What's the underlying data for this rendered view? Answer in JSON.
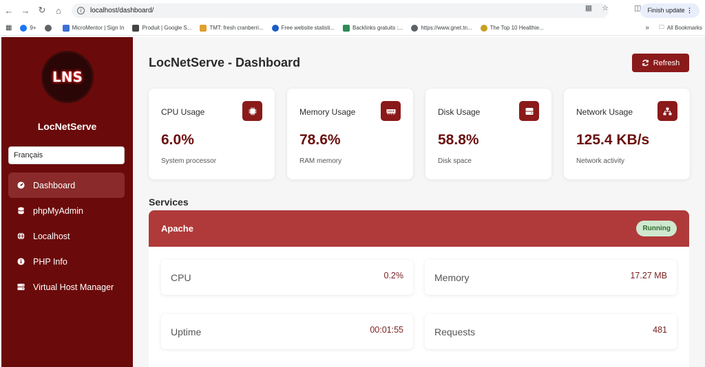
{
  "browser": {
    "url": "localhost/dashboard/",
    "finish_update": "Finish update",
    "bookmarks": [
      {
        "label": "9+",
        "color": "#1877f2"
      },
      {
        "label": "",
        "color": "#5f6368"
      },
      {
        "label": "MicroMentor | Sign In",
        "color": "#3b6fd4"
      },
      {
        "label": "Produit | Google S...",
        "color": "#444444"
      },
      {
        "label": "TMT: fresh cranberri...",
        "color": "#e0a030"
      },
      {
        "label": "Free website statisti...",
        "color": "#1a5cc8"
      },
      {
        "label": "Backlinks gratuits :...",
        "color": "#2e8b57"
      },
      {
        "label": "https://www.gnet.tn...",
        "color": "#5f6368"
      },
      {
        "label": "The Top 10 Healthie...",
        "color": "#c8a020"
      }
    ],
    "overflow": "»",
    "all_bookmarks": "All Bookmarks"
  },
  "sidebar": {
    "logo_text": "LNS",
    "brand": "LocNetServe",
    "language": "Français",
    "items": [
      {
        "label": "Dashboard",
        "icon": "gauge-icon",
        "active": true
      },
      {
        "label": "phpMyAdmin",
        "icon": "database-icon",
        "active": false
      },
      {
        "label": "Localhost",
        "icon": "globe-icon",
        "active": false
      },
      {
        "label": "PHP Info",
        "icon": "info-icon",
        "active": false
      },
      {
        "label": "Virtual Host Manager",
        "icon": "server-icon",
        "active": false
      }
    ]
  },
  "header": {
    "title": "LocNetServe - Dashboard",
    "refresh_label": "Refresh"
  },
  "cards": [
    {
      "label": "CPU Usage",
      "value": "6.0%",
      "sub": "System processor",
      "icon": "cpu-icon"
    },
    {
      "label": "Memory Usage",
      "value": "78.6%",
      "sub": "RAM memory",
      "icon": "memory-icon"
    },
    {
      "label": "Disk Usage",
      "value": "58.8%",
      "sub": "Disk space",
      "icon": "disk-icon"
    },
    {
      "label": "Network Usage",
      "value": "125.4 KB/s",
      "sub": "Network activity",
      "icon": "network-icon"
    }
  ],
  "services": {
    "title": "Services",
    "service": {
      "name": "Apache",
      "status": "Running",
      "metrics": [
        {
          "label": "CPU",
          "value": "0.2%"
        },
        {
          "label": "Memory",
          "value": "17.27 MB"
        },
        {
          "label": "Uptime",
          "value": "00:01:55"
        },
        {
          "label": "Requests",
          "value": "481"
        }
      ]
    }
  },
  "colors": {
    "sidebar": "#6b0a0a",
    "accent": "#8b1a1a",
    "service_header": "#b03a3a",
    "status_bg": "#cfe8cf"
  }
}
